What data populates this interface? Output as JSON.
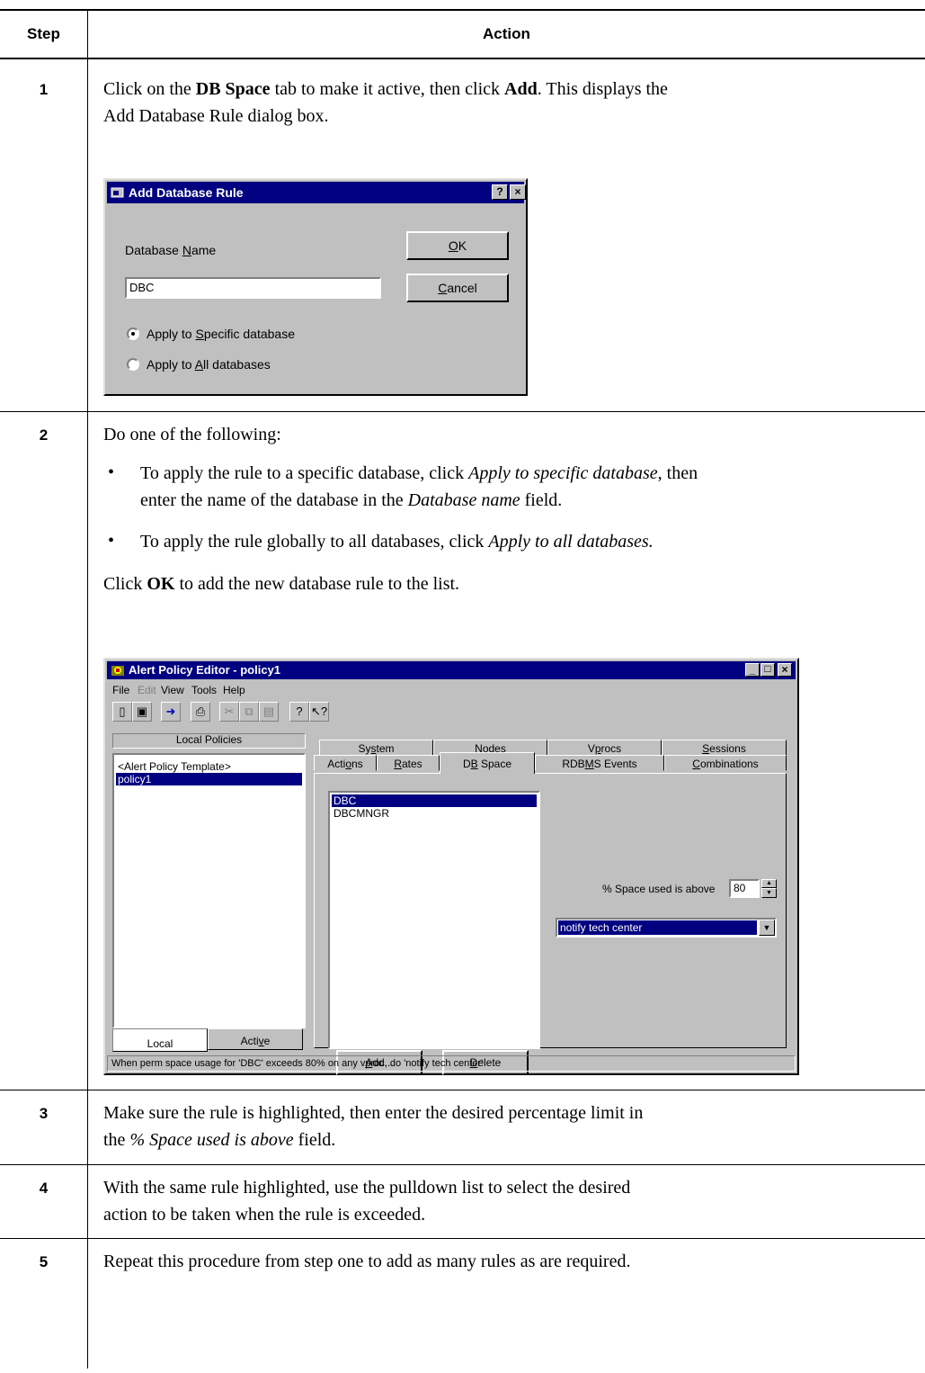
{
  "table": {
    "header_step": "Step",
    "header_action": "Action"
  },
  "steps": [
    {
      "num": "1",
      "text_parts": [
        "Click on the ",
        "DB Space",
        " tab to make it active, then click ",
        "Add",
        ". This displays the",
        "Add Database Rule dialog box."
      ]
    },
    {
      "num": "2",
      "intro": "Do one of the following:",
      "bullet1": [
        "To apply the rule to a specific database, click ",
        "Apply to specific database",
        ", then",
        "enter the name of the database in the ",
        "Database name",
        " field."
      ],
      "bullet2": [
        "To apply the rule globally to all databases, click ",
        "Apply to all databases."
      ],
      "closing": [
        "Click ",
        "OK",
        " to add the new database rule to the list."
      ]
    },
    {
      "num": "3",
      "text": [
        "Make sure the rule is highlighted, then enter the desired percentage limit in",
        "the ",
        "% Space used is above",
        " field."
      ]
    },
    {
      "num": "4",
      "text": [
        "With the same rule highlighted, use the pulldown list to select the desired",
        "action to be taken when the rule is exceeded."
      ]
    },
    {
      "num": "5",
      "text": "Repeat this procedure from step one to add as many rules as are required."
    }
  ],
  "dialog": {
    "title": "Add Database Rule",
    "help_btn": "?",
    "close_btn": "×",
    "db_name_label": "Database Name",
    "db_name_value": "DBC",
    "ok": "OK",
    "cancel": "Cancel",
    "radio_specific": "Apply to Specific database",
    "radio_all": "Apply to All databases",
    "selected_radio": "specific"
  },
  "app": {
    "title": "Alert Policy Editor - policy1",
    "menu": [
      "File",
      "Edit",
      "View",
      "Tools",
      "Help"
    ],
    "local_policies": "Local Policies",
    "policies": [
      "<Alert Policy Template>",
      "policy1"
    ],
    "selected_policy": "policy1",
    "bottom_tabs": [
      "Local",
      "Active"
    ],
    "tabs_row1": [
      "System",
      "Nodes",
      "Vprocs",
      "Sessions"
    ],
    "tabs_row2": [
      "Actions",
      "Rates",
      "DB Space",
      "RDBMS Events",
      "Combinations"
    ],
    "active_tab": "DB Space",
    "databases": [
      "DBC",
      "DBCMNGR"
    ],
    "selected_db": "DBC",
    "space_label": "% Space used is above",
    "space_value": "80",
    "action_value": "notify tech center",
    "add_btn": "Add...",
    "delete_btn": "Delete",
    "status": "When perm space usage for 'DBC' exceeds 80% on any vproc, do 'notify tech center'"
  }
}
